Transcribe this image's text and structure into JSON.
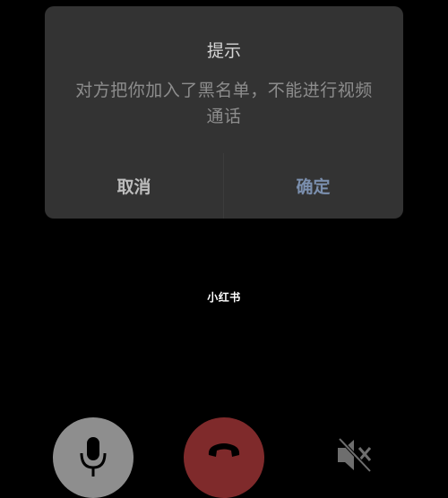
{
  "dialog": {
    "title": "提示",
    "message": "对方把你加入了黑名单，不能进行视频通话",
    "cancel_label": "取消",
    "confirm_label": "确定"
  },
  "watermark": "小红书",
  "controls": {
    "mic_icon": "microphone-icon",
    "hangup_icon": "phone-hangup-icon",
    "speaker_icon": "speaker-muted-icon"
  },
  "colors": {
    "dialog_bg": "#333333",
    "confirm_accent": "#7b8fae",
    "hangup_red": "#7f2a2b",
    "mic_gray": "#8e8e8e"
  }
}
